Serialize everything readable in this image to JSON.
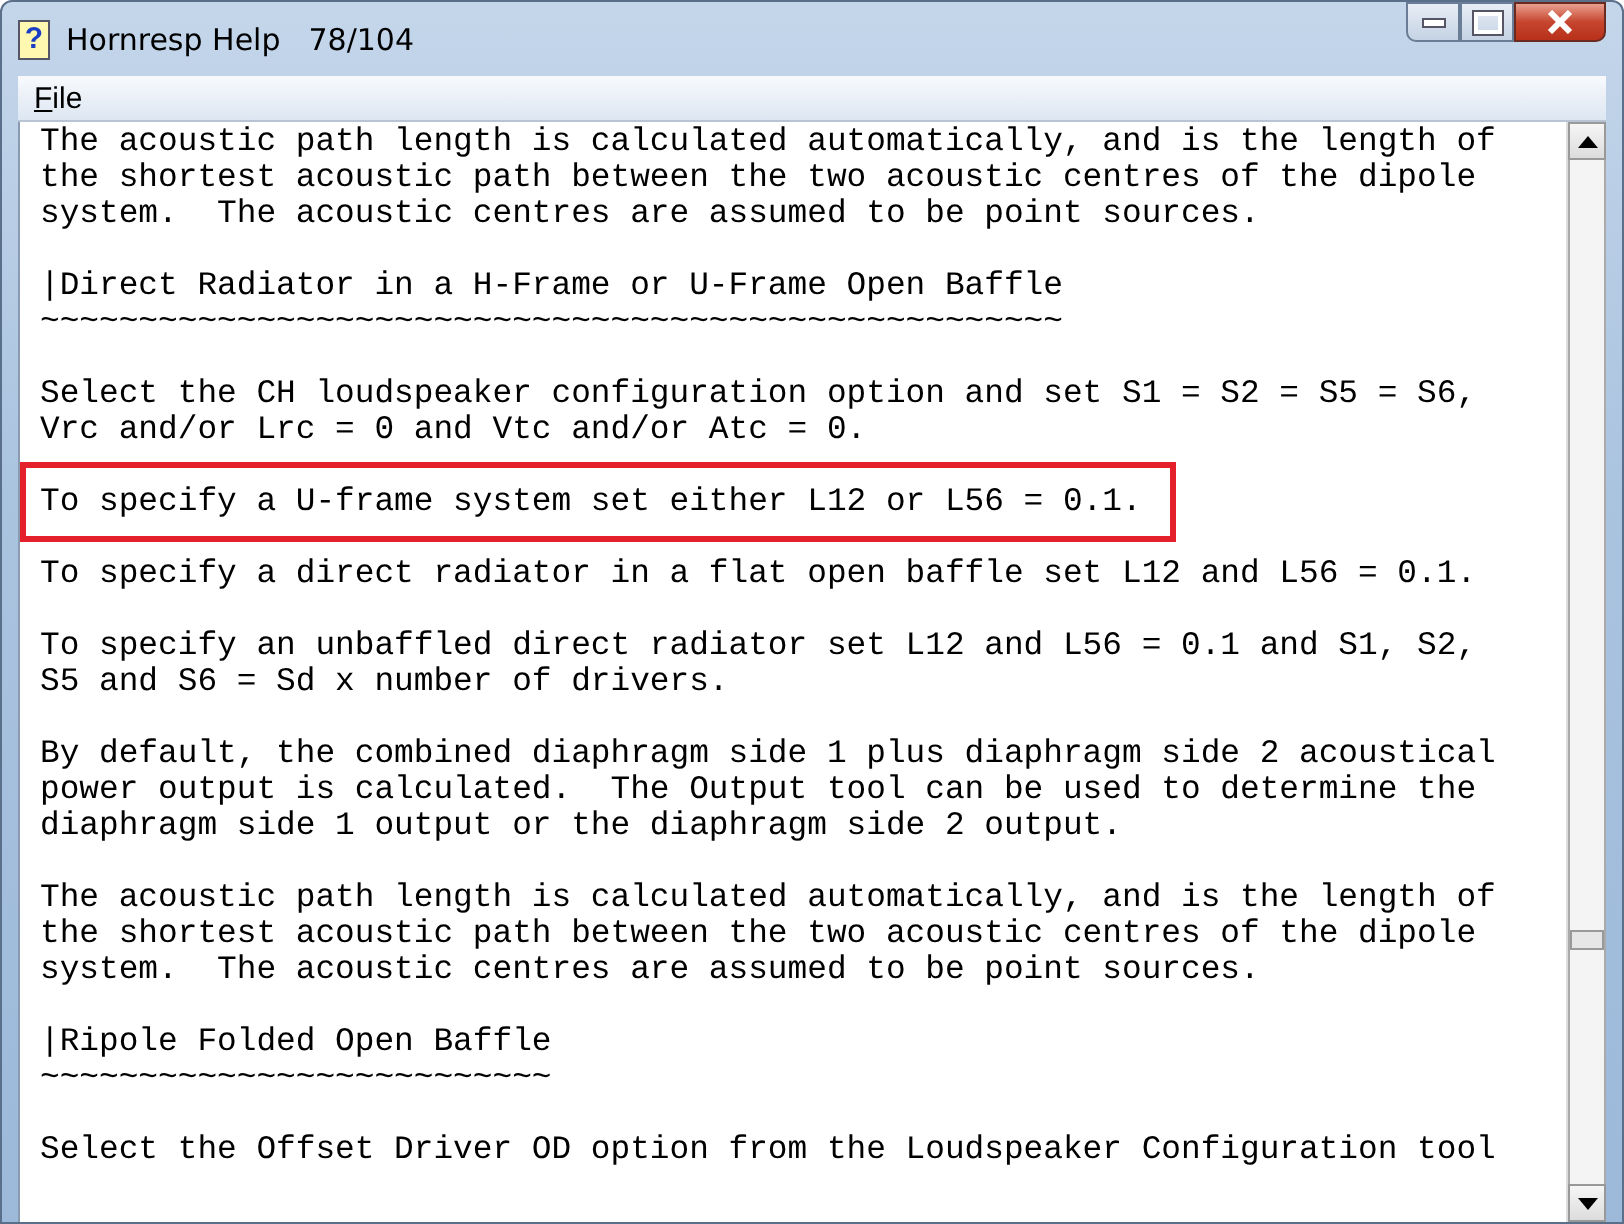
{
  "window": {
    "icon": "?",
    "title": "Hornresp Help",
    "page": "78/104"
  },
  "menu": [
    {
      "label": "File"
    }
  ],
  "blocks": [
    {
      "kind": "paragraph",
      "highlighted": false,
      "text": "The acoustic path length is calculated automatically, and is the length of\nthe shortest acoustic path between the two acoustic centres of the dipole\nsystem.  The acoustic centres are assumed to be point sources."
    },
    {
      "kind": "heading",
      "text": "|Direct Radiator in a H-Frame or U-Frame Open Baffle",
      "underline": "~~~~~~~~~~~~~~~~~~~~~~~~~~~~~~~~~~~~~~~~~~~~~~~~~~~~"
    },
    {
      "kind": "paragraph",
      "highlighted": false,
      "text": "Select the CH loudspeaker configuration option and set S1 = S2 = S5 = S6,\nVrc and/or Lrc = 0 and Vtc and/or Atc = 0."
    },
    {
      "kind": "paragraph",
      "highlighted": true,
      "text": "To specify a U-frame system set either L12 or L56 = 0.1."
    },
    {
      "kind": "paragraph",
      "highlighted": false,
      "text": "To specify a direct radiator in a flat open baffle set L12 and L56 = 0.1."
    },
    {
      "kind": "paragraph",
      "highlighted": false,
      "text": "To specify an unbaffled direct radiator set L12 and L56 = 0.1 and S1, S2,\nS5 and S6 = Sd x number of drivers."
    },
    {
      "kind": "paragraph",
      "highlighted": false,
      "text": "By default, the combined diaphragm side 1 plus diaphragm side 2 acoustical\npower output is calculated.  The Output tool can be used to determine the\ndiaphragm side 1 output or the diaphragm side 2 output."
    },
    {
      "kind": "paragraph",
      "highlighted": false,
      "text": "The acoustic path length is calculated automatically, and is the length of\nthe shortest acoustic path between the two acoustic centres of the dipole\nsystem.  The acoustic centres are assumed to be point sources."
    },
    {
      "kind": "heading",
      "text": "|Ripole Folded Open Baffle",
      "underline": "~~~~~~~~~~~~~~~~~~~~~~~~~~"
    },
    {
      "kind": "paragraph",
      "highlighted": false,
      "text": "Select the Offset Driver OD option from the Loudspeaker Configuration tool"
    }
  ]
}
